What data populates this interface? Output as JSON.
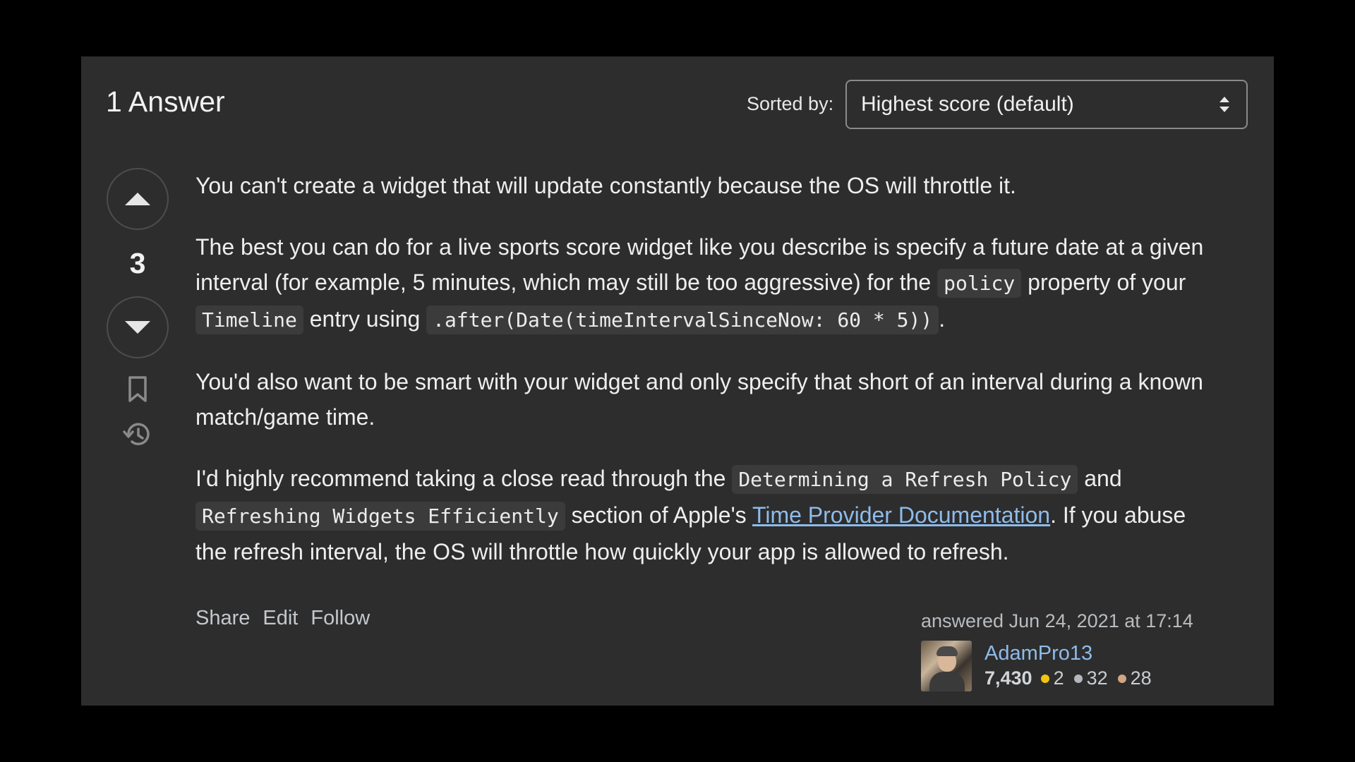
{
  "header": {
    "answer_count": "1 Answer",
    "sort_label": "Sorted by:",
    "sort_value": "Highest score (default)"
  },
  "vote": {
    "count": "3"
  },
  "post": {
    "p1": "You can't create a widget that will update constantly because the OS will throttle it.",
    "p2_a": "The best you can do for a live sports score widget like you describe is specify a future date at a given interval (for example, 5 minutes, which may still be too aggressive) for the ",
    "p2_code1": "policy",
    "p2_b": " property of your ",
    "p2_code2": "Timeline",
    "p2_c": " entry using ",
    "p2_code3": ".after(Date(timeIntervalSinceNow: 60 * 5))",
    "p2_d": ".",
    "p3": "You'd also want to be smart with your widget and only specify that short of an interval during a known match/game time.",
    "p4_a": "I'd highly recommend taking a close read through the ",
    "p4_code1": "Determining a Refresh Policy",
    "p4_b": " and ",
    "p4_code2": "Refreshing Widgets Efficiently",
    "p4_c": " section of Apple's ",
    "p4_link": "Time Provider Documentation",
    "p4_d": ". If you abuse the refresh interval, the OS will throttle how quickly your app is allowed to refresh."
  },
  "menu": {
    "share": "Share",
    "edit": "Edit",
    "follow": "Follow"
  },
  "user": {
    "action": "answered Jun 24, 2021 at 17:14",
    "name": "AdamPro13",
    "reputation": "7,430",
    "gold": "2",
    "silver": "32",
    "bronze": "28"
  },
  "colors": {
    "panel_bg": "#2d2d2d",
    "link": "#8fbbea",
    "gold": "#f1c40f",
    "silver": "#b4b8bc",
    "bronze": "#d1a684"
  },
  "icons": [
    "upvote-arrow-icon",
    "downvote-arrow-icon",
    "bookmark-icon",
    "history-icon",
    "sort-arrows-icon"
  ]
}
